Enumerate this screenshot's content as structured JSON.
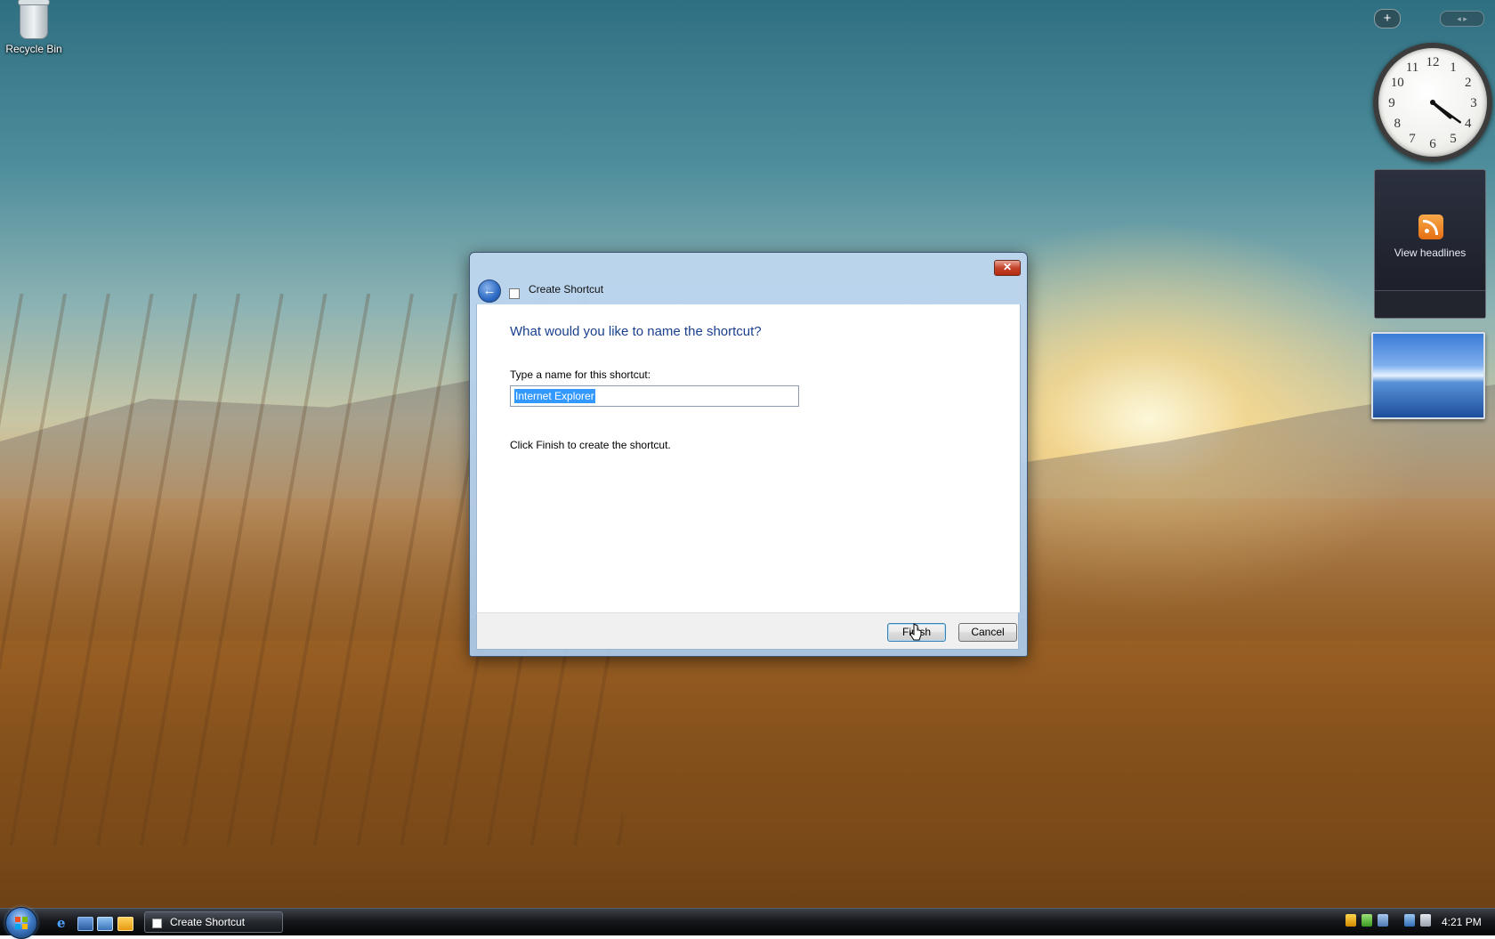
{
  "desktop": {
    "icons": [
      {
        "label": "Recycle Bin",
        "icon": "recycle-bin-icon"
      }
    ]
  },
  "sidebar": {
    "add_label": "+",
    "nav_label": "◂ ▸",
    "clock": {
      "hours": [
        12,
        1,
        2,
        3,
        4,
        5,
        6,
        7,
        8,
        9,
        10,
        11
      ],
      "time": "4:21"
    },
    "feed": {
      "label": "View headlines",
      "icon": "rss-icon"
    },
    "slideshow": {
      "icon": "slideshow-picture"
    }
  },
  "dialog": {
    "title": "Create Shortcut",
    "close_symbol": "✕",
    "back_symbol": "←",
    "heading": "What would you like to name the shortcut?",
    "field_label": "Type a name for this shortcut:",
    "field_value": "Internet Explorer",
    "hint": "Click Finish to create the shortcut.",
    "buttons": {
      "finish": "Finish",
      "cancel": "Cancel"
    },
    "accent": "#1b3f8f"
  },
  "taskbar": {
    "start_icon": "windows-start-orb",
    "quick_launch": [
      {
        "icon": "internet-explorer-icon",
        "glyph": "e"
      },
      {
        "icon": "show-desktop-icon"
      },
      {
        "icon": "switch-windows-icon"
      },
      {
        "icon": "media-player-icon"
      }
    ],
    "task_label": "Create Shortcut",
    "tray_icons": [
      "security-shield-icon",
      "network-icon",
      "volume-icon",
      "display-icon",
      "safely-remove-icon"
    ],
    "time": "4:21 PM"
  }
}
